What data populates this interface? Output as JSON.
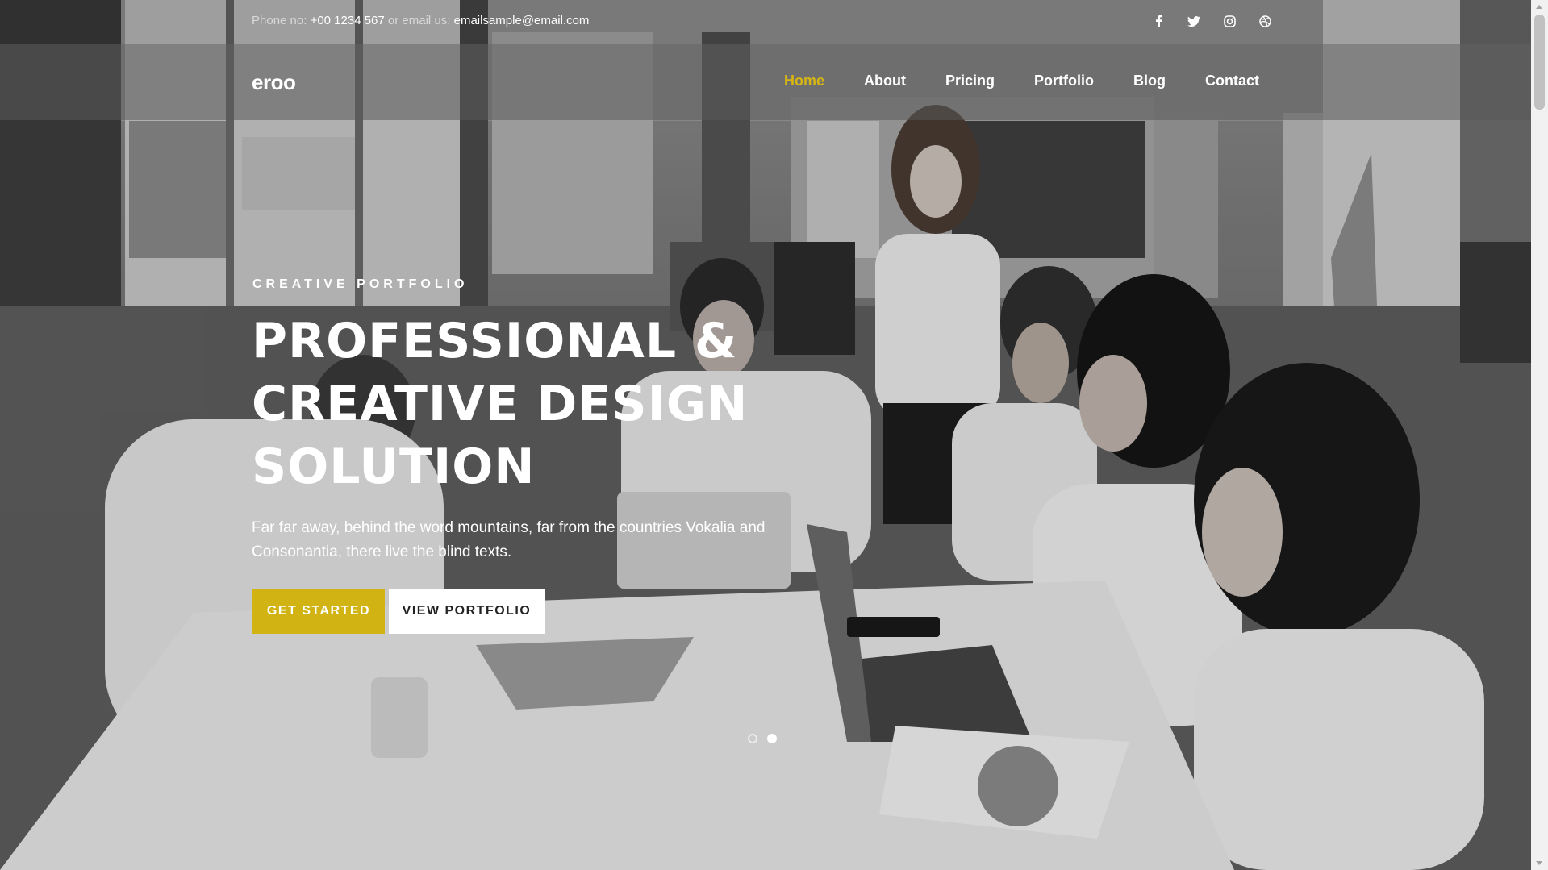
{
  "topbar": {
    "phone_label": "Phone no: ",
    "phone_value": "+00 1234 567",
    "email_label": " or email us: ",
    "email_value": "emailsample@email.com",
    "social": [
      "facebook-icon",
      "twitter-icon",
      "instagram-icon",
      "dribbble-icon"
    ]
  },
  "navbar": {
    "logo": "eroo",
    "items": [
      {
        "label": "Home",
        "active": true
      },
      {
        "label": "About"
      },
      {
        "label": "Pricing"
      },
      {
        "label": "Portfolio"
      },
      {
        "label": "Blog"
      },
      {
        "label": "Contact"
      }
    ]
  },
  "hero": {
    "eyebrow": "CREATIVE PORTFOLIO",
    "headline": [
      "PROFESSIONAL &",
      "CREATIVE DESIGN",
      "SOLUTION"
    ],
    "lede": "Far far away, behind the word mountains, far from the countries Vokalia and Consonantia, there live the blind texts.",
    "primary_button": "GET STARTED",
    "secondary_button": "VIEW PORTFOLIO",
    "slides": 2,
    "active_slide": 2
  },
  "colors": {
    "accent": "#d1b413",
    "active_nav": "#d6b613"
  }
}
